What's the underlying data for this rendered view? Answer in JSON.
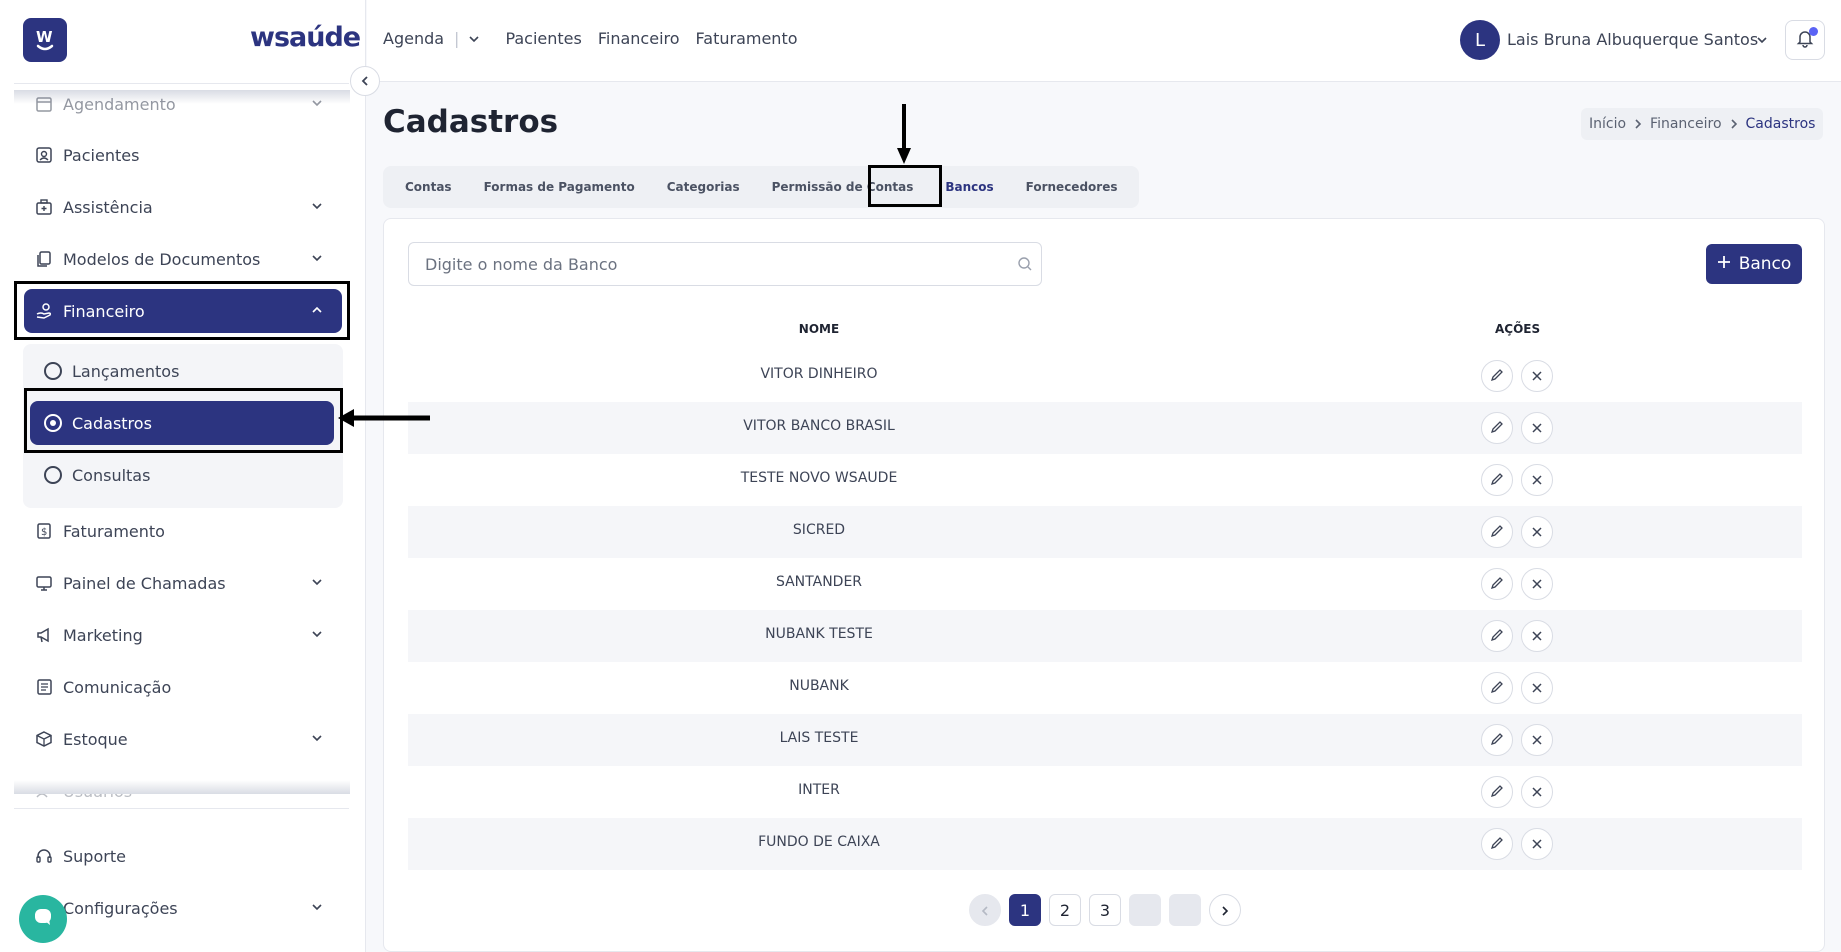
{
  "brand": {
    "logo_text": "wsaúde"
  },
  "sidebar": {
    "items": [
      {
        "label": "Agendamento",
        "icon": "calendar-icon",
        "has_chevron": true
      },
      {
        "label": "Pacientes",
        "icon": "user-badge-icon",
        "has_chevron": false
      },
      {
        "label": "Assistência",
        "icon": "medical-bag-icon",
        "has_chevron": true
      },
      {
        "label": "Modelos de Documentos",
        "icon": "documents-icon",
        "has_chevron": true
      },
      {
        "label": "Financeiro",
        "icon": "hand-money-icon",
        "has_chevron": true,
        "active": true
      },
      {
        "label": "Faturamento",
        "icon": "dollar-doc-icon",
        "has_chevron": false
      },
      {
        "label": "Painel de Chamadas",
        "icon": "monitor-icon",
        "has_chevron": true
      },
      {
        "label": "Marketing",
        "icon": "megaphone-icon",
        "has_chevron": true
      },
      {
        "label": "Comunicação",
        "icon": "newspaper-icon",
        "has_chevron": false
      },
      {
        "label": "Estoque",
        "icon": "box-icon",
        "has_chevron": true
      },
      {
        "label": "Usuários",
        "icon": "users-icon",
        "has_chevron": false
      }
    ],
    "sub_items": [
      {
        "label": "Lançamentos"
      },
      {
        "label": "Cadastros",
        "active": true
      },
      {
        "label": "Consultas"
      }
    ],
    "bottom_items": [
      {
        "label": "Suporte",
        "icon": "headset-icon"
      },
      {
        "label": "Configurações",
        "icon": "gear-icon"
      }
    ]
  },
  "topbar": {
    "nav": [
      "Agenda",
      "Pacientes",
      "Financeiro",
      "Faturamento"
    ],
    "user_initial": "L",
    "user_name": "Lais Bruna Albuquerque Santos"
  },
  "page": {
    "title": "Cadastros",
    "breadcrumb": [
      "Início",
      "Financeiro",
      "Cadastros"
    ]
  },
  "tabs": [
    "Contas",
    "Formas de Pagamento",
    "Categorias",
    "Permissão de Contas",
    "Bancos",
    "Fornecedores"
  ],
  "active_tab": "Bancos",
  "search": {
    "placeholder": "Digite o nome da Banco",
    "value": ""
  },
  "add_button": {
    "label": "Banco"
  },
  "table": {
    "headers": [
      "NOME",
      "AÇÕES"
    ],
    "rows": [
      "VITOR DINHEIRO",
      "VITOR BANCO BRASIL",
      "TESTE NOVO WSAUDE",
      "SICRED",
      "SANTANDER",
      "NUBANK TESTE",
      "NUBANK",
      "LAIS TESTE",
      "INTER",
      "FUNDO DE CAIXA"
    ]
  },
  "pagination": {
    "pages": [
      "1",
      "2",
      "3"
    ],
    "current": "1"
  },
  "colors": {
    "primary": "#2c3480",
    "accent": "#3aa6c8",
    "chat": "#29b6a0"
  }
}
